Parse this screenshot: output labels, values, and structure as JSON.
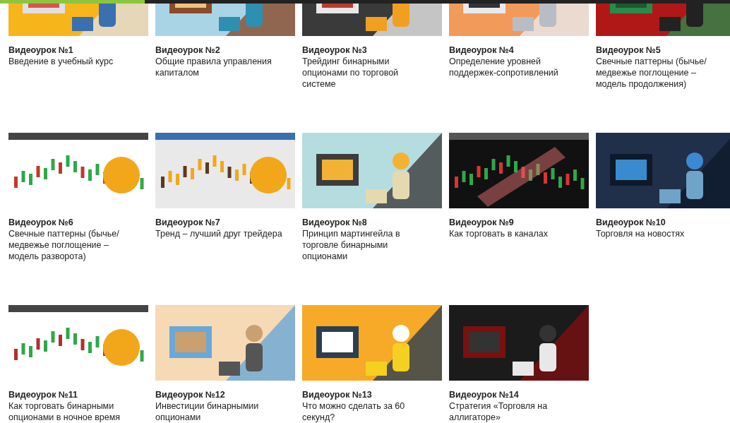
{
  "lessons": [
    {
      "title": "Видеоурок №1",
      "description": "Введение в учебный курс"
    },
    {
      "title": "Видеоурок №2",
      "description": "Общие правила управления капиталом"
    },
    {
      "title": "Видеоурок №3",
      "description": "Трейдинг бинарными опционами по торговой системе"
    },
    {
      "title": "Видеоурок №4",
      "description": "Определение уровней поддержек-сопротивлений"
    },
    {
      "title": "Видеоурок №5",
      "description": "Свечные паттерны (бычье/ медвежье поглощение – модель продолжения)"
    },
    {
      "title": "Видеоурок №6",
      "description": "Свечные паттерны (бычье/ медвежье поглощение – модель разворота)"
    },
    {
      "title": "Видеоурок №7",
      "description": "Тренд – лучший друг трейдера"
    },
    {
      "title": "Видеоурок №8",
      "description": "Принцип мартингейла в торговле бинарными опционами"
    },
    {
      "title": "Видеоурок №9",
      "description": "Как торговать в каналах"
    },
    {
      "title": "Видеоурок №10",
      "description": "Торговля на новостях"
    },
    {
      "title": "Видеоурок №11",
      "description": "Как торговать бинарными опционами в ночное время"
    },
    {
      "title": "Видеоурок №12",
      "description": "Инвестиции бинарнымии опционами"
    },
    {
      "title": "Видеоурок №13",
      "description": "Что можно сделать за 60 секунд?"
    },
    {
      "title": "Видеоурок №14",
      "description": "Стратегия «Торговля на аллигаторе»"
    }
  ]
}
